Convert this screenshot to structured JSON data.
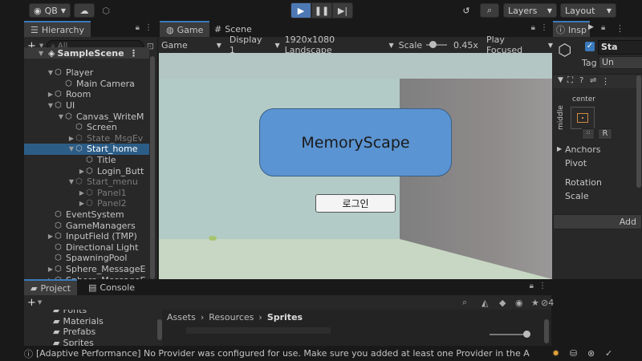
{
  "toolbar": {
    "account": "QB",
    "layers": "Layers",
    "layout": "Layout"
  },
  "hierarchy": {
    "tab": "Hierarchy",
    "search_placeholder": "All",
    "scene": "SampleScene",
    "nodes": [
      {
        "label": "Player",
        "indent": 1,
        "arrow": "▼",
        "dim": false
      },
      {
        "label": "Main Camera",
        "indent": 2,
        "arrow": "",
        "dim": false
      },
      {
        "label": "Room",
        "indent": 1,
        "arrow": "▶",
        "dim": false
      },
      {
        "label": "UI",
        "indent": 1,
        "arrow": "▼",
        "dim": false
      },
      {
        "label": "Canvas_WriteM",
        "indent": 2,
        "arrow": "▼",
        "dim": false
      },
      {
        "label": "Screen",
        "indent": 3,
        "arrow": "",
        "dim": false
      },
      {
        "label": "State_MsgEv",
        "indent": 3,
        "arrow": "▶",
        "dim": true
      },
      {
        "label": "Start_home",
        "indent": 3,
        "arrow": "▼",
        "dim": false,
        "selected": true
      },
      {
        "label": "Title",
        "indent": 4,
        "arrow": "",
        "dim": false
      },
      {
        "label": "Login_Butt",
        "indent": 4,
        "arrow": "▶",
        "dim": false
      },
      {
        "label": "Start_menu",
        "indent": 3,
        "arrow": "▼",
        "dim": true
      },
      {
        "label": "Panel1",
        "indent": 4,
        "arrow": "▶",
        "dim": true
      },
      {
        "label": "Panel2",
        "indent": 4,
        "arrow": "▶",
        "dim": true
      },
      {
        "label": "EventSystem",
        "indent": 1,
        "arrow": "",
        "dim": false
      },
      {
        "label": "GameManagers",
        "indent": 1,
        "arrow": "",
        "dim": false
      },
      {
        "label": "InputField (TMP)",
        "indent": 1,
        "arrow": "▶",
        "dim": false
      },
      {
        "label": "Directional Light",
        "indent": 1,
        "arrow": "",
        "dim": false
      },
      {
        "label": "SpawningPool",
        "indent": 1,
        "arrow": "",
        "dim": false
      },
      {
        "label": "Sphere_MessageE",
        "indent": 1,
        "arrow": "▶",
        "dim": false
      },
      {
        "label": "Sphere_MessageE",
        "indent": 1,
        "arrow": "▶",
        "dim": false
      }
    ]
  },
  "game": {
    "tab_game": "Game",
    "tab_scene": "Scene",
    "mode": "Game",
    "display": "Display 1",
    "resolution": "1920x1080 Landscape",
    "scale_label": "Scale",
    "scale_value": "0.45x",
    "play_mode": "Play Focused",
    "title_panel": "MemoryScape",
    "login_button": "로그인"
  },
  "inspector": {
    "tab": "Insp",
    "object_name": "Sta",
    "tag_label": "Tag",
    "tag_value": "Un",
    "anchor_top": "center",
    "anchor_side": "middle",
    "anchors": "Anchors",
    "pivot": "Pivot",
    "rotation": "Rotation",
    "scale": "Scale",
    "add_button": "Add",
    "r_label": "R"
  },
  "project": {
    "tab_project": "Project",
    "tab_console": "Console",
    "folders": [
      "Fonts",
      "Materials",
      "Prefabs",
      "Sprites"
    ],
    "breadcrumb": [
      "Assets",
      "Resources",
      "Sprites"
    ],
    "badge_count": "4"
  },
  "status": {
    "message": "[Adaptive Performance] No Provider was configured for use. Make sure you added at least one Provider in the Adaptive Per"
  },
  "colors": {
    "accent": "#3a79bb",
    "selected": "#2c5d87",
    "play_active": "#4d78b4",
    "title_panel": "#5b94d2"
  }
}
